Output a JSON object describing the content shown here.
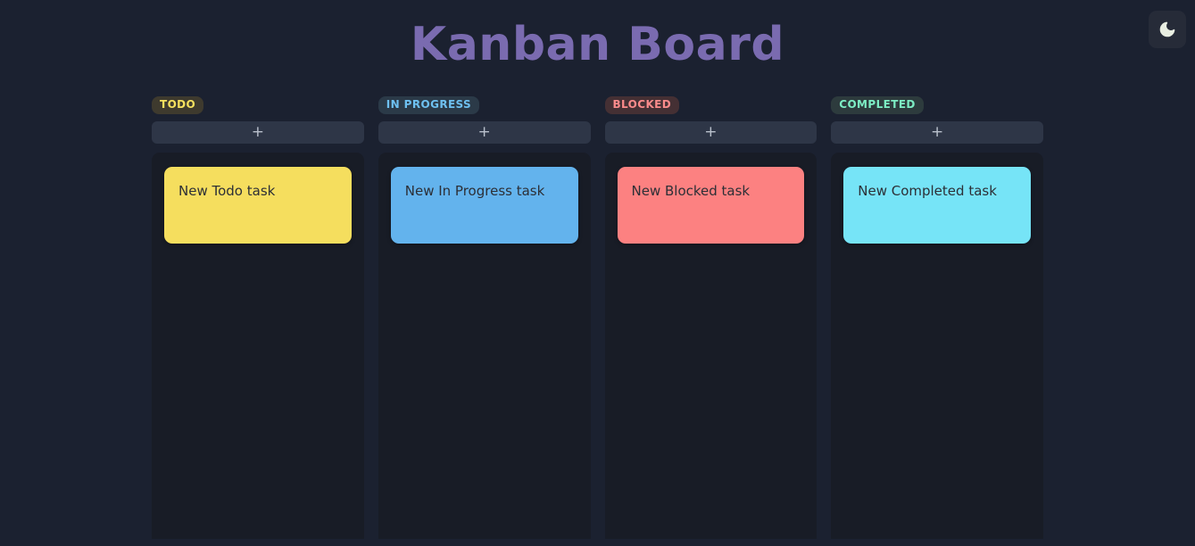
{
  "page": {
    "title": "Kanban Board",
    "background_color": "#1b2130",
    "title_color": "#7a6bb0"
  },
  "theme_toggle": {
    "icon": "moon-icon",
    "label": "",
    "icon_color": "#e8eee2",
    "background_color": "#262b38"
  },
  "columns": [
    {
      "id": "todo",
      "badge_label": "TODO",
      "badge_text_color": "#f5e05e",
      "badge_bg_color": "#3e3a2e",
      "add_button_label": "+",
      "body_color": "#181c26",
      "cards": [
        {
          "text": "New Todo task",
          "color": "#f5de5e",
          "text_color": "#2c2f36"
        }
      ]
    },
    {
      "id": "in-progress",
      "badge_label": "IN PROGRESS",
      "badge_text_color": "#6ec0f0",
      "badge_bg_color": "#2b3a48",
      "add_button_label": "+",
      "body_color": "#181c26",
      "cards": [
        {
          "text": "New In Progress task",
          "color": "#63b3ed",
          "text_color": "#2c2f36"
        }
      ]
    },
    {
      "id": "blocked",
      "badge_label": "BLOCKED",
      "badge_text_color": "#fb8b8b",
      "badge_bg_color": "#453034",
      "add_button_label": "+",
      "body_color": "#181c26",
      "cards": [
        {
          "text": "New Blocked task",
          "color": "#fc8181",
          "text_color": "#2c2f36"
        }
      ]
    },
    {
      "id": "completed",
      "badge_label": "COMPLETED",
      "badge_text_color": "#7dedc4",
      "badge_bg_color": "#2d3b3d",
      "add_button_label": "+",
      "body_color": "#181c26",
      "cards": [
        {
          "text": "New Completed task",
          "color": "#76e4f7",
          "text_color": "#2c2f36"
        }
      ]
    }
  ]
}
